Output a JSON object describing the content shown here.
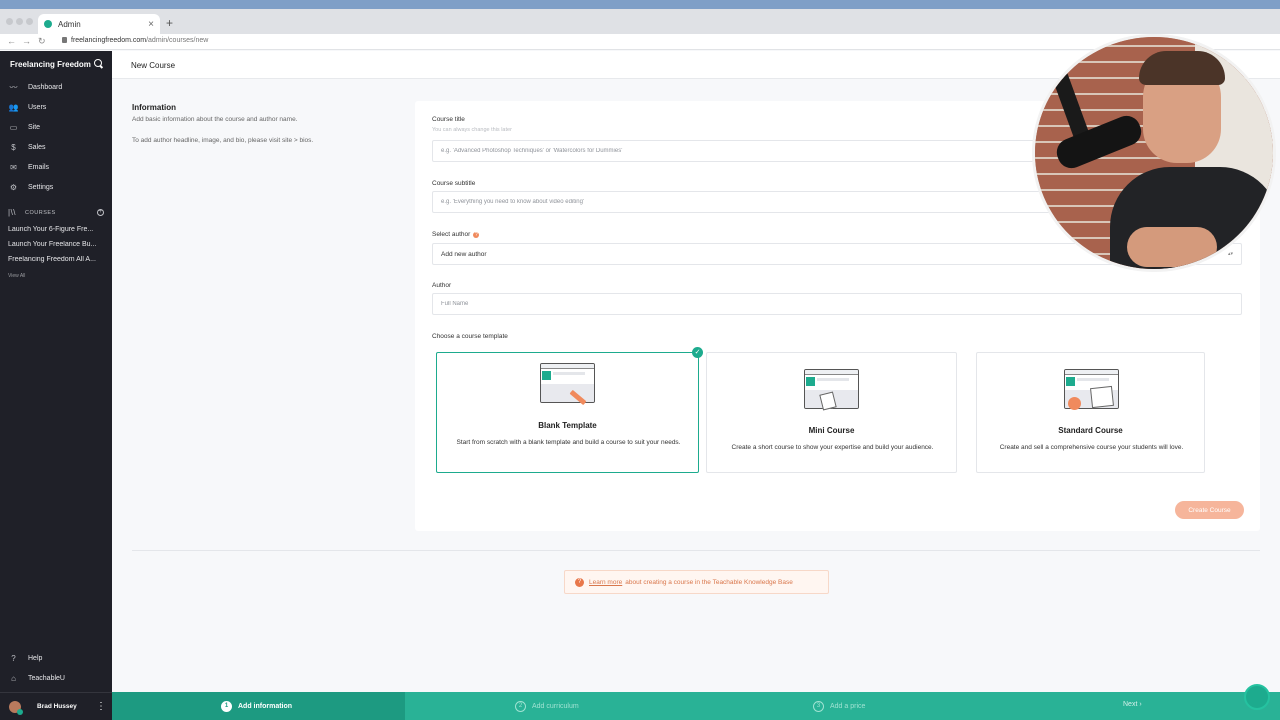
{
  "browser": {
    "tab_title": "Admin",
    "url_domain": "freelancingfreedom.com",
    "url_path": "/admin/courses/new"
  },
  "sidebar": {
    "brand": "Freelancing Freedom",
    "nav": [
      {
        "label": "Dashboard",
        "icon": "chart-line-icon"
      },
      {
        "label": "Users",
        "icon": "users-icon"
      },
      {
        "label": "Site",
        "icon": "monitor-icon"
      },
      {
        "label": "Sales",
        "icon": "dollar-icon"
      },
      {
        "label": "Emails",
        "icon": "envelope-icon"
      },
      {
        "label": "Settings",
        "icon": "gear-icon"
      }
    ],
    "courses_heading": "COURSES",
    "courses": [
      "Launch Your 6-Figure Fre...",
      "Launch Your Freelance Bu...",
      "Freelancing Freedom All A..."
    ],
    "view_all": "View All",
    "help": "Help",
    "teachableu": "TeachableU",
    "user_name": "Brad Hussey"
  },
  "header": {
    "title": "New Course"
  },
  "info": {
    "title": "Information",
    "description": "Add basic information about the course and author name.",
    "note": "To add author headline, image, and bio, please visit site > bios."
  },
  "form": {
    "course_title_label": "Course title",
    "course_title_hint": "You can always change this later",
    "course_title_placeholder": "e.g. 'Advanced Photoshop Techniques' or 'Watercolors for Dummies'",
    "course_subtitle_label": "Course subtitle",
    "course_subtitle_placeholder": "e.g. 'Everything you need to know about video editing'",
    "select_author_label": "Select author",
    "select_author_value": "Add new author",
    "author_label": "Author",
    "author_placeholder": "Full Name",
    "template_label": "Choose a course template"
  },
  "templates": [
    {
      "title": "Blank Template",
      "description": "Start from scratch with a blank template and build a course to suit your needs.",
      "selected": true
    },
    {
      "title": "Mini Course",
      "description": "Create a short course to show your expertise and build your audience.",
      "selected": false
    },
    {
      "title": "Standard Course",
      "description": "Create and sell a comprehensive course your students will love.",
      "selected": false
    }
  ],
  "create_button": "Create Course",
  "kb_banner": {
    "link": "Learn more",
    "text": "about creating a course in the Teachable Knowledge Base"
  },
  "steps": [
    {
      "num": "1",
      "label": "Add information",
      "active": true
    },
    {
      "num": "2",
      "label": "Add curriculum",
      "active": false
    },
    {
      "num": "3",
      "label": "Add a price",
      "active": false
    }
  ],
  "next": "Next ›",
  "colors": {
    "brand_green": "#1dab8e",
    "sidebar_bg": "#1f2028",
    "accent_orange": "#f08a5d"
  }
}
